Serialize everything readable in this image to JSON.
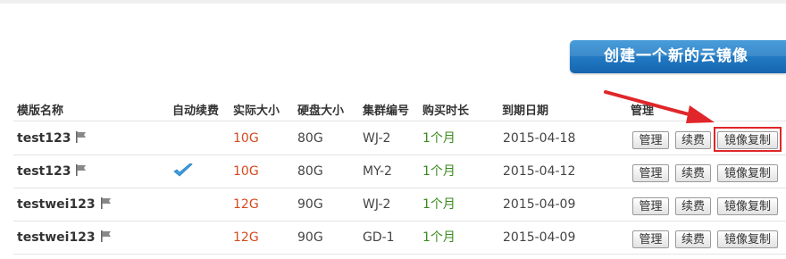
{
  "create_button_label": "创建一个新的云镜像",
  "columns": {
    "name": "模版名称",
    "auto_renew": "自动续费",
    "actual_size": "实际大小",
    "disk_size": "硬盘大小",
    "cluster": "集群编号",
    "duration": "购买时长",
    "expiry": "到期日期",
    "manage": "管理"
  },
  "rows": [
    {
      "name": "test123",
      "auto_renew": false,
      "actual_size": "10G",
      "disk_size": "80G",
      "cluster": "WJ-2",
      "duration": "1个月",
      "expiry": "2015-04-18"
    },
    {
      "name": "test123",
      "auto_renew": true,
      "actual_size": "10G",
      "disk_size": "80G",
      "cluster": "MY-2",
      "duration": "1个月",
      "expiry": "2015-04-12"
    },
    {
      "name": "testwei123",
      "auto_renew": false,
      "actual_size": "12G",
      "disk_size": "90G",
      "cluster": "WJ-2",
      "duration": "1个月",
      "expiry": "2015-04-09"
    },
    {
      "name": "testwei123",
      "auto_renew": false,
      "actual_size": "12G",
      "disk_size": "90G",
      "cluster": "GD-1",
      "duration": "1个月",
      "expiry": "2015-04-09"
    }
  ],
  "actions": {
    "manage": "管理",
    "renew": "续费",
    "copy": "镜像复制"
  },
  "colors": {
    "accent": "#1e78c8",
    "size_text": "#d44a1e",
    "duration_text": "#3b8a1e",
    "highlight": "#e0262a"
  },
  "icons": {
    "flag": "flag-icon",
    "check": "check-icon"
  }
}
